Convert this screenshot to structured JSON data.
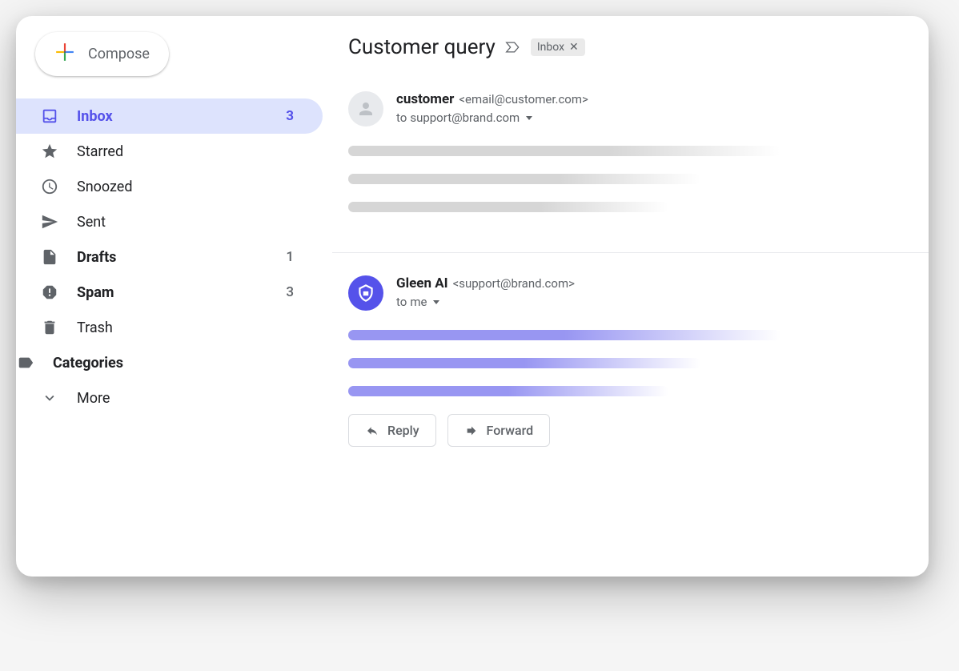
{
  "compose": {
    "label": "Compose"
  },
  "sidebar": {
    "items": [
      {
        "label": "Inbox",
        "count": "3",
        "icon": "inbox-icon",
        "active": true,
        "bold": true
      },
      {
        "label": "Starred",
        "count": "",
        "icon": "star-icon",
        "active": false,
        "bold": false
      },
      {
        "label": "Snoozed",
        "count": "",
        "icon": "clock-icon",
        "active": false,
        "bold": false
      },
      {
        "label": "Sent",
        "count": "",
        "icon": "send-icon",
        "active": false,
        "bold": false
      },
      {
        "label": "Drafts",
        "count": "1",
        "icon": "file-icon",
        "active": false,
        "bold": true
      },
      {
        "label": "Spam",
        "count": "3",
        "icon": "spam-icon",
        "active": false,
        "bold": true
      },
      {
        "label": "Trash",
        "count": "",
        "icon": "trash-icon",
        "active": false,
        "bold": false
      },
      {
        "label": "Categories",
        "count": "",
        "icon": "label-icon",
        "active": false,
        "bold": true,
        "collapsible": true
      },
      {
        "label": "More",
        "count": "",
        "icon": "chevron-down-icon",
        "active": false,
        "bold": false
      }
    ]
  },
  "thread": {
    "subject": "Customer query",
    "label": "Inbox"
  },
  "messages": [
    {
      "sender_name": "customer",
      "sender_email": "<email@customer.com>",
      "recipient_prefix": "to",
      "recipient": "support@brand.com",
      "avatar_type": "person",
      "body_tone": "grey"
    },
    {
      "sender_name": "Gleen AI",
      "sender_email": "<support@brand.com>",
      "recipient_prefix": "to",
      "recipient": "me",
      "avatar_type": "gleen",
      "body_tone": "purple"
    }
  ],
  "actions": {
    "reply": "Reply",
    "forward": "Forward"
  },
  "colors": {
    "accent": "#5552ea",
    "accent_light": "#dde3fd",
    "skeleton_grey": "#d6d6d6",
    "skeleton_purple": "#9896f2"
  }
}
